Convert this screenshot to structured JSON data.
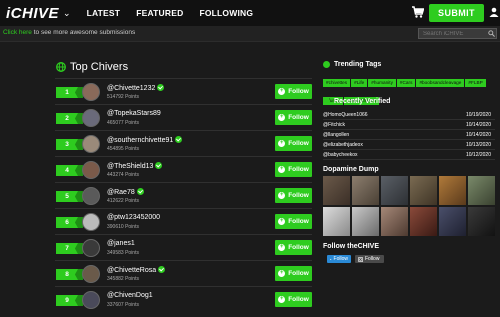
{
  "nav": {
    "logo": "iCHIVE",
    "links": [
      "LATEST",
      "FEATURED",
      "FOLLOWING"
    ],
    "submit": "SUBMIT"
  },
  "subbar": {
    "link": "Click here",
    "text": " to see more awesome submissions",
    "search_placeholder": "Search iCHIVE"
  },
  "main": {
    "title": "Top Chivers",
    "follow_label": "Follow",
    "rows": [
      {
        "rank": "1",
        "name": "@Chivette1232",
        "points": "514792 Points",
        "verified": true
      },
      {
        "rank": "2",
        "name": "@TopekaStars89",
        "points": "465077 Points",
        "verified": false
      },
      {
        "rank": "3",
        "name": "@southernchivette91",
        "points": "454895 Points",
        "verified": true
      },
      {
        "rank": "4",
        "name": "@TheShield13",
        "points": "443274 Points",
        "verified": true
      },
      {
        "rank": "5",
        "name": "@Rae78",
        "points": "412622 Points",
        "verified": true
      },
      {
        "rank": "6",
        "name": "@ptw123452000",
        "points": "390610 Points",
        "verified": false
      },
      {
        "rank": "7",
        "name": "@janes1",
        "points": "349583 Points",
        "verified": false
      },
      {
        "rank": "8",
        "name": "@ChivetteRosa",
        "points": "345882 Points",
        "verified": true
      },
      {
        "rank": "9",
        "name": "@ChivenDog1",
        "points": "337607 Points",
        "verified": false
      }
    ]
  },
  "sidebar": {
    "trending_title": "Trending Tags",
    "tags": [
      "#chivettes",
      "#Life",
      "#humanity",
      "#Cars",
      "#boobsandcleavage",
      "#FLBP",
      "#funny",
      "#SexyChivers"
    ],
    "verified_title": "Recently Verified",
    "verified": [
      {
        "name": "@HomoQueen1066",
        "date": "10/19/2020"
      },
      {
        "name": "@Fitchick",
        "date": "10/14/2020"
      },
      {
        "name": "@llangollen",
        "date": "10/14/2020"
      },
      {
        "name": "@elizabethjadeox",
        "date": "10/13/2020"
      },
      {
        "name": "@babycheekox",
        "date": "10/12/2020"
      }
    ],
    "dump_title": "Dopamine Dump",
    "follow_title": "Follow theCHIVE",
    "twitter": "Follow",
    "instagram": "Follow"
  },
  "colors": {
    "accent": "#2ecc1f",
    "background": "#1b1b1b",
    "nav": "#111111"
  }
}
